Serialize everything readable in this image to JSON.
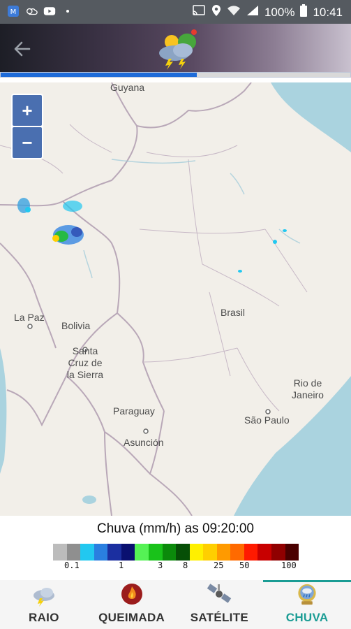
{
  "status_bar": {
    "battery": "100%",
    "time": "10:41",
    "notification_icons": [
      "app-icon",
      "cloud-icon",
      "youtube-icon",
      "dot-icon"
    ],
    "system_icons": [
      "cast-icon",
      "location-icon",
      "wifi-icon",
      "signal-icon",
      "battery-icon"
    ]
  },
  "header": {
    "back_icon": "arrow-left-icon",
    "logo_icon": "storm-cloud-icon"
  },
  "progress": {
    "fraction": 0.56
  },
  "map": {
    "zoom_in_label": "+",
    "zoom_out_label": "−",
    "labels": {
      "guyana": "Guyana",
      "la_paz": "La Paz",
      "bolivia": "Bolivia",
      "santa_cruz_1": "Santa",
      "santa_cruz_2": "Cruz de",
      "santa_cruz_3": "la Sierra",
      "brasil": "Brasil",
      "paraguay": "Paraguay",
      "asuncion": "Asunción",
      "rio_1": "Rio de",
      "rio_2": "Janeiro",
      "sao_paulo": "São Paulo"
    },
    "colors": {
      "land": "#f2efe9",
      "ocean": "#aad3df",
      "border": "#b9a8b8"
    }
  },
  "legend": {
    "title": "Chuva (mm/h) as 09:20:00",
    "colors": [
      "#bcbcbc",
      "#8f8f8f",
      "#22c8f0",
      "#2a7fe0",
      "#1b2fa0",
      "#0a1070",
      "#55f255",
      "#19c21a",
      "#0b8a0b",
      "#064f06",
      "#fff000",
      "#ffcf00",
      "#ff9a00",
      "#ff6a00",
      "#ff1a00",
      "#c80000",
      "#900000",
      "#4a0000"
    ],
    "ticks": [
      "0.1",
      "1",
      "3",
      "8",
      "25",
      "50",
      "100"
    ]
  },
  "bottom_nav": [
    {
      "label": "RAIO",
      "icon": "cloud-lightning-icon",
      "active": false
    },
    {
      "label": "QUEIMADA",
      "icon": "fire-icon",
      "active": false
    },
    {
      "label": "SATÉLITE",
      "icon": "satellite-icon",
      "active": false
    },
    {
      "label": "CHUVA",
      "icon": "rain-globe-icon",
      "active": true
    }
  ]
}
